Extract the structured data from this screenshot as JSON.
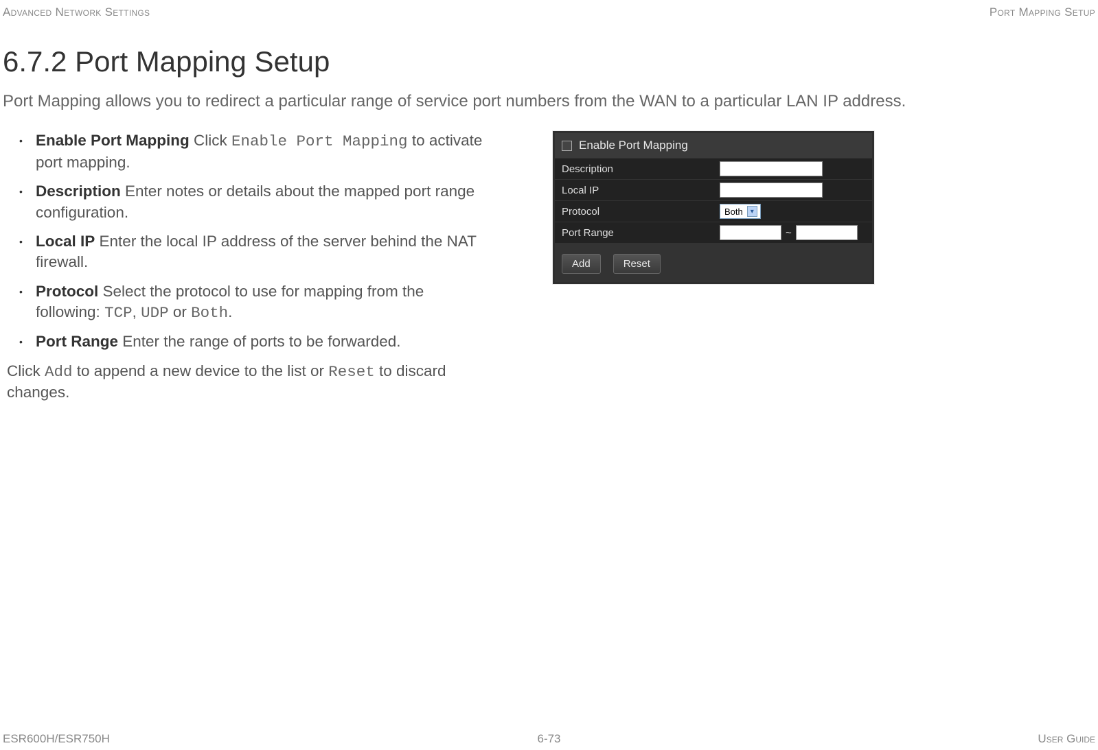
{
  "header": {
    "left": "Advanced Network Settings",
    "right": "Port Mapping Setup"
  },
  "title": "6.7.2 Port Mapping Setup",
  "intro": "Port Mapping allows you to redirect a particular range of service port numbers from the WAN to a particular LAN IP address.",
  "bullets": {
    "b1": {
      "label": "Enable Port Mapping",
      "pre": "  Click ",
      "code": "Enable Port Mapping",
      "post": " to activate port mapping."
    },
    "b2": {
      "label": "Description",
      "text": "  Enter notes or details about the mapped port range configuration."
    },
    "b3": {
      "label": "Local IP",
      "text": "  Enter the local IP address of the server behind the NAT firewall."
    },
    "b4": {
      "label": "Protocol",
      "pre": "  Select the protocol to use for mapping from the following: ",
      "c1": "TCP",
      "sep1": ", ",
      "c2": "UDP",
      "sep2": " or ",
      "c3": "Both",
      "post": "."
    },
    "b5": {
      "label": "Port Range",
      "text": "  Enter the range of ports to be forwarded."
    }
  },
  "afterList": {
    "pre": "Click ",
    "c1": "Add",
    "mid": " to append a new device to the list or ",
    "c2": "Reset",
    "post": " to discard changes."
  },
  "screenshot": {
    "enableLabel": "Enable Port Mapping",
    "rows": {
      "description": "Description",
      "localIp": "Local IP",
      "protocol": "Protocol",
      "portRange": "Port Range"
    },
    "protocolValue": "Both",
    "tilde": "~",
    "buttons": {
      "add": "Add",
      "reset": "Reset"
    }
  },
  "footer": {
    "left": "ESR600H/ESR750H",
    "center": "6-73",
    "right": "User Guide"
  }
}
